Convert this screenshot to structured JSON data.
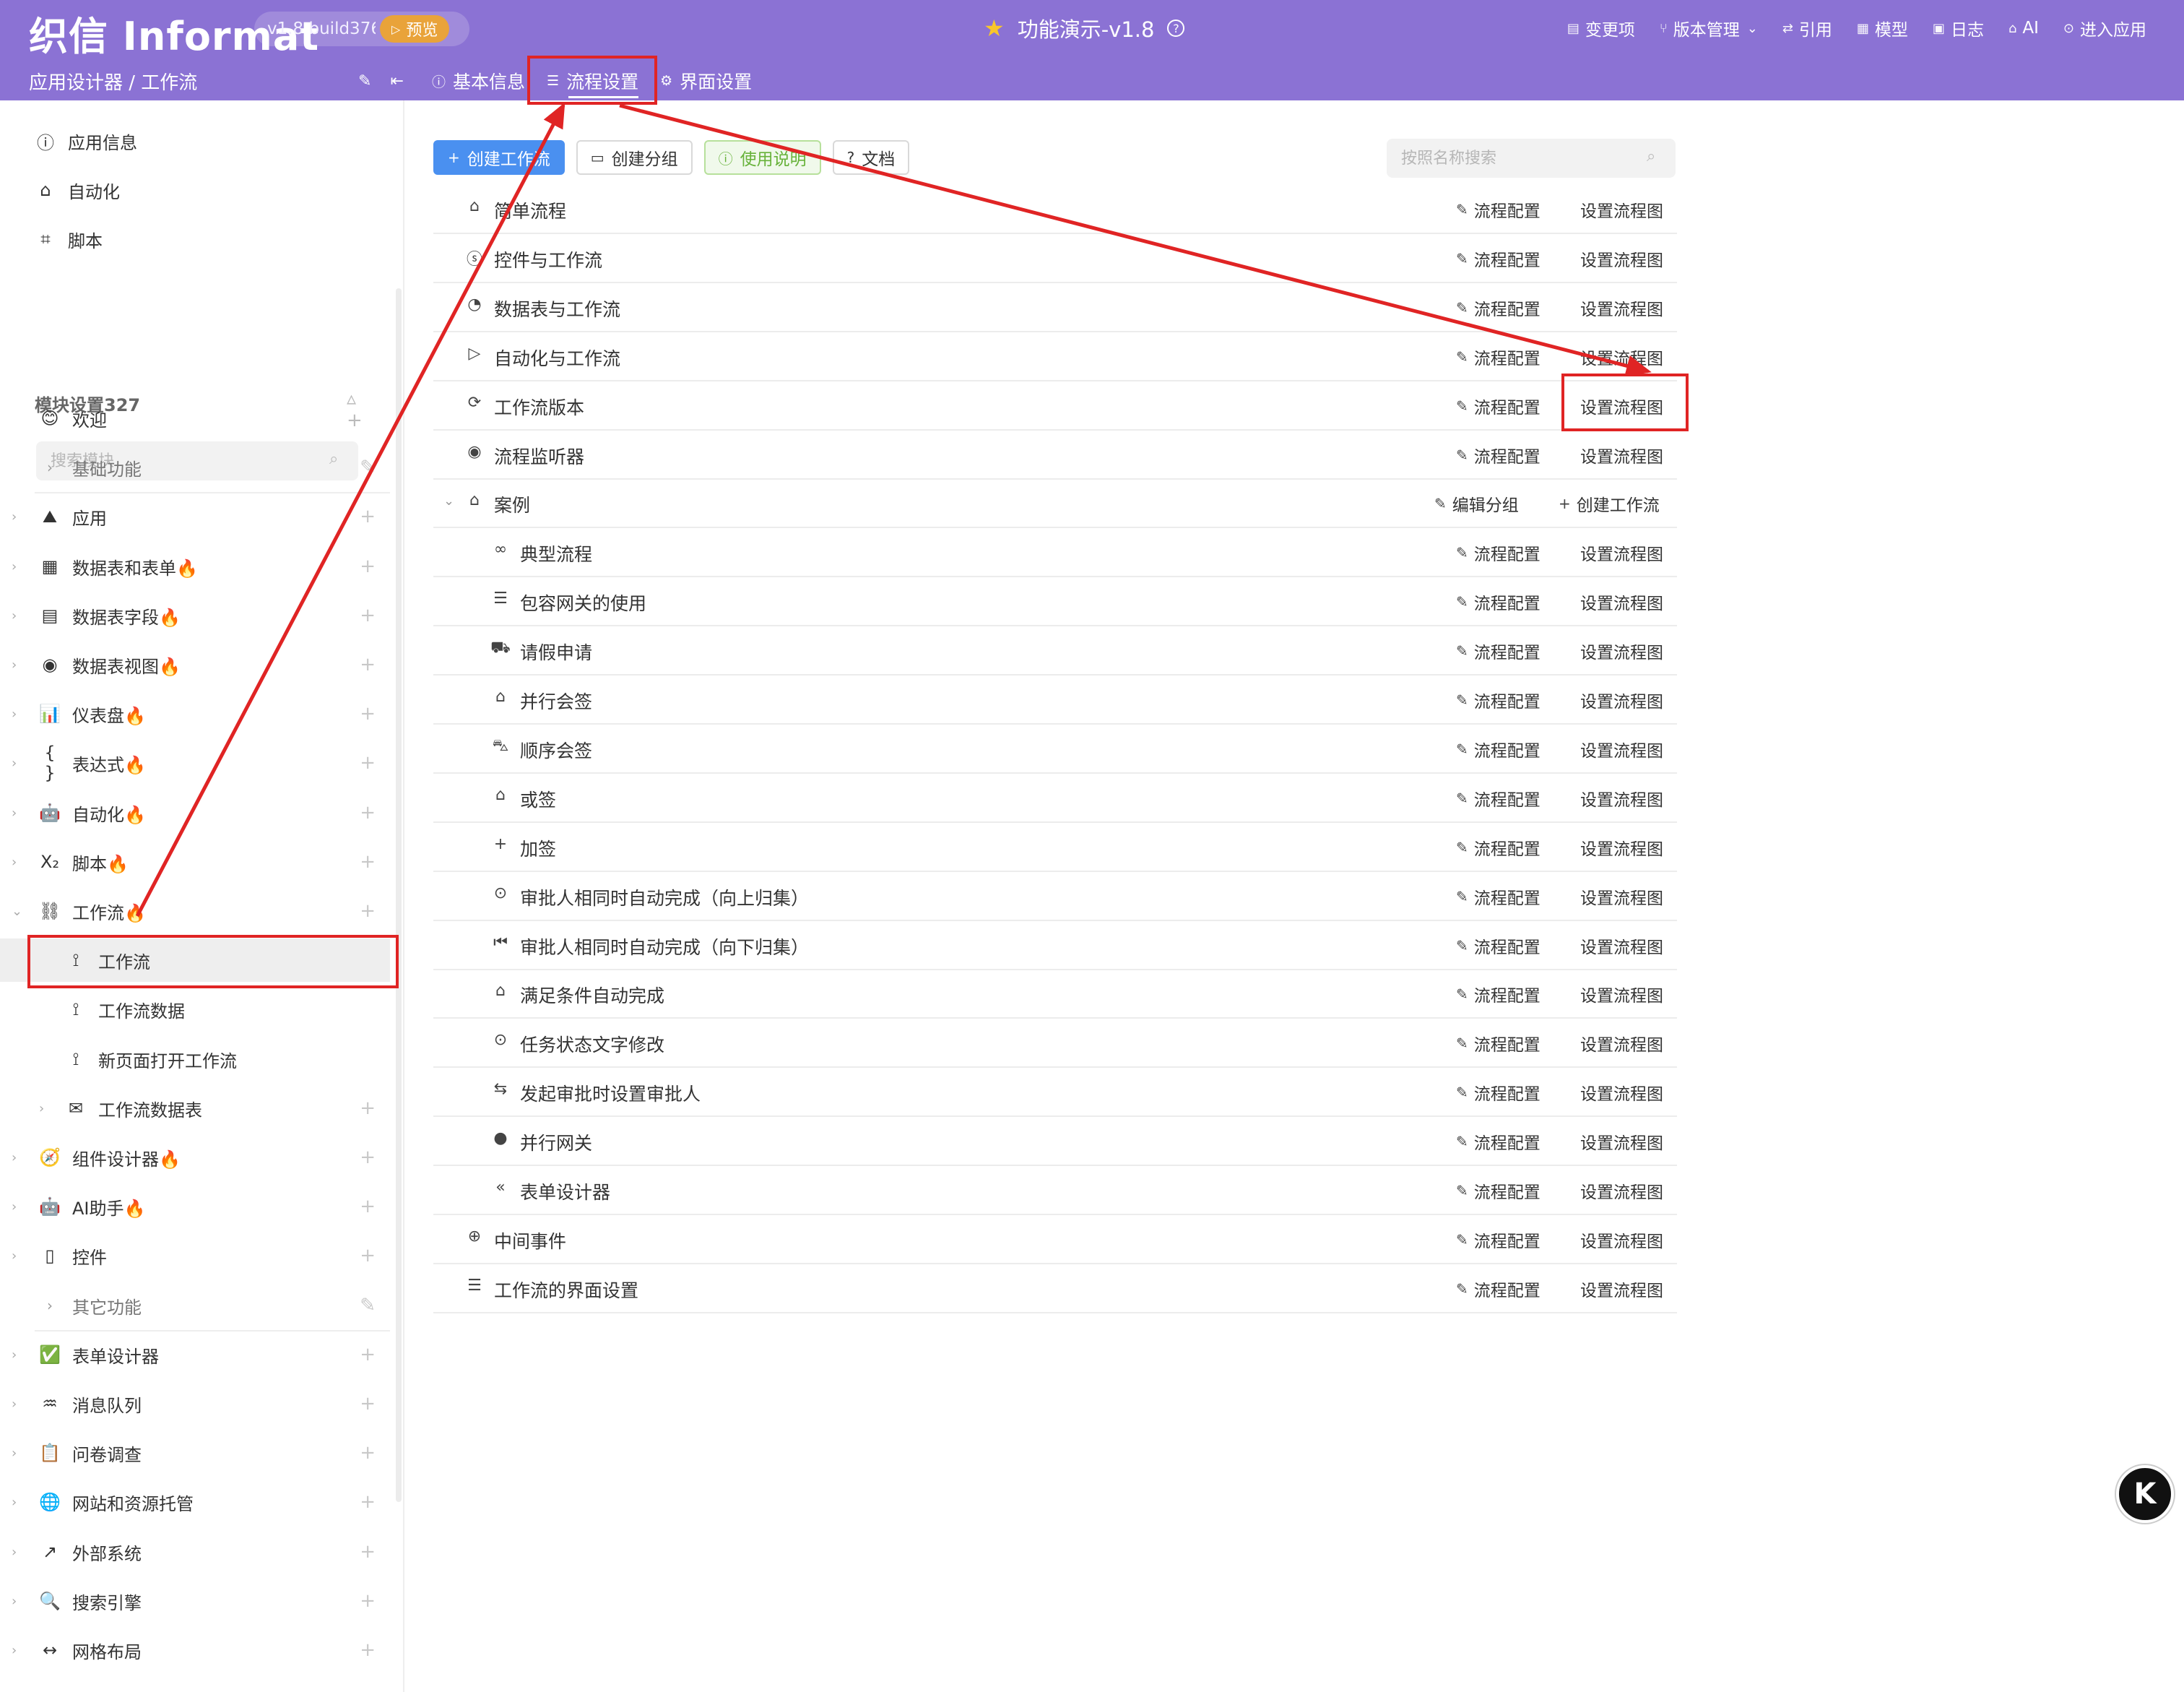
{
  "header": {
    "logo": "织信 Informat",
    "version": "v1.8 build376",
    "preview_label": "预览",
    "app_title": "功能演示-v1.8",
    "menu": [
      {
        "icon": "list-icon",
        "glyph": "▤",
        "label": "变更项"
      },
      {
        "icon": "branch-icon",
        "glyph": "⑂",
        "label": "版本管理",
        "dropdown": "⌄"
      },
      {
        "icon": "link-icon",
        "glyph": "⇄",
        "label": "引用"
      },
      {
        "icon": "table-icon",
        "glyph": "▦",
        "label": "模型"
      },
      {
        "icon": "log-icon",
        "glyph": "▣",
        "label": "日志"
      },
      {
        "icon": "ai-icon",
        "glyph": "⌂",
        "label": "AI"
      },
      {
        "icon": "enter-icon",
        "glyph": "⊙",
        "label": "进入应用"
      }
    ],
    "breadcrumb": "应用设计器 / 工作流",
    "tabs": [
      {
        "icon": "info-icon",
        "glyph": "ⓘ",
        "label": "基本信息"
      },
      {
        "icon": "flow-settings-icon",
        "glyph": "☰",
        "label": "流程设置"
      },
      {
        "icon": "gear-icon",
        "glyph": "⚙",
        "label": "界面设置"
      }
    ]
  },
  "sidebar": {
    "top_items": [
      {
        "icon": "info-icon",
        "glyph": "ⓘ",
        "label": "应用信息"
      },
      {
        "icon": "robot-icon",
        "glyph": "⌂",
        "label": "自动化"
      },
      {
        "icon": "script-icon",
        "glyph": "⌗",
        "label": "脚本"
      }
    ],
    "module_title": "模块设置327",
    "search_placeholder": "搜索模块",
    "modules": [
      {
        "icon": "smile-icon",
        "glyph": "😊",
        "label": "欢迎",
        "level": 1
      },
      {
        "icon": "chevron-right-icon",
        "glyph": "›",
        "label": "基础功能",
        "level": 1,
        "muted": true
      },
      {
        "icon": "mountain-icon",
        "glyph": "⛰",
        "label": "应用",
        "level": 0
      },
      {
        "icon": "table-icon",
        "glyph": "▦",
        "label": "数据表和表单🔥",
        "level": 0
      },
      {
        "icon": "grid-icon",
        "glyph": "▤",
        "label": "数据表字段🔥",
        "level": 0
      },
      {
        "icon": "view-icon",
        "glyph": "◉",
        "label": "数据表视图🔥",
        "level": 0
      },
      {
        "icon": "chart-icon",
        "glyph": "📊",
        "label": "仪表盘🔥",
        "level": 0
      },
      {
        "icon": "braces-icon",
        "glyph": "{ }",
        "label": "表达式🔥",
        "level": 0
      },
      {
        "icon": "robot-icon",
        "glyph": "🤖",
        "label": "自动化🔥",
        "level": 0
      },
      {
        "icon": "subscript-icon",
        "glyph": "X₂",
        "label": "脚本🔥",
        "level": 0
      },
      {
        "icon": "workflow-icon",
        "glyph": "⛓",
        "label": "工作流🔥",
        "level": 0,
        "expanded": true
      },
      {
        "icon": "flow-node-icon",
        "glyph": "⟟",
        "label": "工作流",
        "level": 2,
        "selected": true
      },
      {
        "icon": "flow-node-icon",
        "glyph": "⟟",
        "label": "工作流数据",
        "level": 2
      },
      {
        "icon": "flow-node-icon",
        "glyph": "⟟",
        "label": "新页面打开工作流",
        "level": 2
      },
      {
        "icon": "mail-icon",
        "glyph": "✉",
        "label": "工作流数据表",
        "level": 1
      },
      {
        "icon": "compass-icon",
        "glyph": "🧭",
        "label": "组件设计器🔥",
        "level": 0
      },
      {
        "icon": "robot-icon",
        "glyph": "🤖",
        "label": "AI助手🔥",
        "level": 0
      },
      {
        "icon": "control-icon",
        "glyph": "▯",
        "label": "控件",
        "level": 0
      },
      {
        "icon": "chevron-right-icon",
        "glyph": "›",
        "label": "其它功能",
        "level": 1,
        "muted": true
      },
      {
        "icon": "check-icon",
        "glyph": "✅",
        "label": "表单设计器",
        "level": 0
      },
      {
        "icon": "queue-icon",
        "glyph": "♒",
        "label": "消息队列",
        "level": 0
      },
      {
        "icon": "clipboard-icon",
        "glyph": "📋",
        "label": "问卷调查",
        "level": 0
      },
      {
        "icon": "globe-icon",
        "glyph": "🌐",
        "label": "网站和资源托管",
        "level": 0
      },
      {
        "icon": "external-icon",
        "glyph": "↗",
        "label": "外部系统",
        "level": 0
      },
      {
        "icon": "search-icon",
        "glyph": "🔍",
        "label": "搜索引擎",
        "level": 0
      },
      {
        "icon": "layout-icon",
        "glyph": "↔",
        "label": "网格布局",
        "level": 0
      }
    ]
  },
  "toolbar": {
    "create_workflow": "创建工作流",
    "create_group": "创建分组",
    "usage": "使用说明",
    "docs": "文档",
    "search_placeholder": "按照名称搜索"
  },
  "actions": {
    "config": "流程配置",
    "diagram": "设置流程图",
    "edit_group": "编辑分组",
    "create_workflow": "创建工作流"
  },
  "workflows": [
    {
      "icon": "home-icon",
      "glyph": "⌂",
      "label": "简单流程",
      "indent": 0
    },
    {
      "icon": "fingerprint-icon",
      "glyph": "ⓢ",
      "label": "控件与工作流",
      "indent": 0
    },
    {
      "icon": "pie-icon",
      "glyph": "◔",
      "label": "数据表与工作流",
      "indent": 0
    },
    {
      "icon": "play-icon",
      "glyph": "▷",
      "label": "自动化与工作流",
      "indent": 0
    },
    {
      "icon": "refresh-icon",
      "glyph": "⟳",
      "label": "工作流版本",
      "indent": 0
    },
    {
      "icon": "target-icon",
      "glyph": "◉",
      "label": "流程监听器",
      "indent": 0
    },
    {
      "icon": "home-icon",
      "glyph": "⌂",
      "label": "案例",
      "indent": 0,
      "group": true
    },
    {
      "icon": "voicemail-icon",
      "glyph": "∞",
      "label": "典型流程",
      "indent": 1
    },
    {
      "icon": "lines-icon",
      "glyph": "☰",
      "label": "包容网关的使用",
      "indent": 1
    },
    {
      "icon": "bed-icon",
      "glyph": "⛟",
      "label": "请假申请",
      "indent": 1
    },
    {
      "icon": "home-icon",
      "glyph": "⌂",
      "label": "并行会签",
      "indent": 1
    },
    {
      "icon": "car-icon",
      "glyph": "⛍",
      "label": "顺序会签",
      "indent": 1
    },
    {
      "icon": "home-alt-icon",
      "glyph": "⌂",
      "label": "或签",
      "indent": 1
    },
    {
      "icon": "plus-icon",
      "glyph": "+",
      "label": "加签",
      "indent": 1
    },
    {
      "icon": "circle-arrow-icon",
      "glyph": "⊙",
      "label": "审批人相同时自动完成（向上归集）",
      "indent": 1
    },
    {
      "icon": "step-back-icon",
      "glyph": "⏮",
      "label": "审批人相同时自动完成（向下归集）",
      "indent": 1
    },
    {
      "icon": "house-icon",
      "glyph": "⌂",
      "label": "满足条件自动完成",
      "indent": 1
    },
    {
      "icon": "circle-arrow-icon",
      "glyph": "⊙",
      "label": "任务状态文字修改",
      "indent": 1
    },
    {
      "icon": "swap-icon",
      "glyph": "⇆",
      "label": "发起审批时设置审批人",
      "indent": 1
    },
    {
      "icon": "gateway-icon",
      "glyph": "●",
      "label": "并行网关",
      "indent": 1
    },
    {
      "icon": "reply-all-icon",
      "glyph": "«",
      "label": "表单设计器",
      "indent": 1
    },
    {
      "icon": "circle-up-icon",
      "glyph": "⊕",
      "label": "中间事件",
      "indent": 0
    },
    {
      "icon": "flow-settings-icon",
      "glyph": "☰",
      "label": "工作流的界面设置",
      "indent": 0
    }
  ],
  "colors": {
    "header_bg": "#8b72d4",
    "primary": "#4a90f0",
    "annotation": "#e02424",
    "preview": "#e9a33a"
  }
}
